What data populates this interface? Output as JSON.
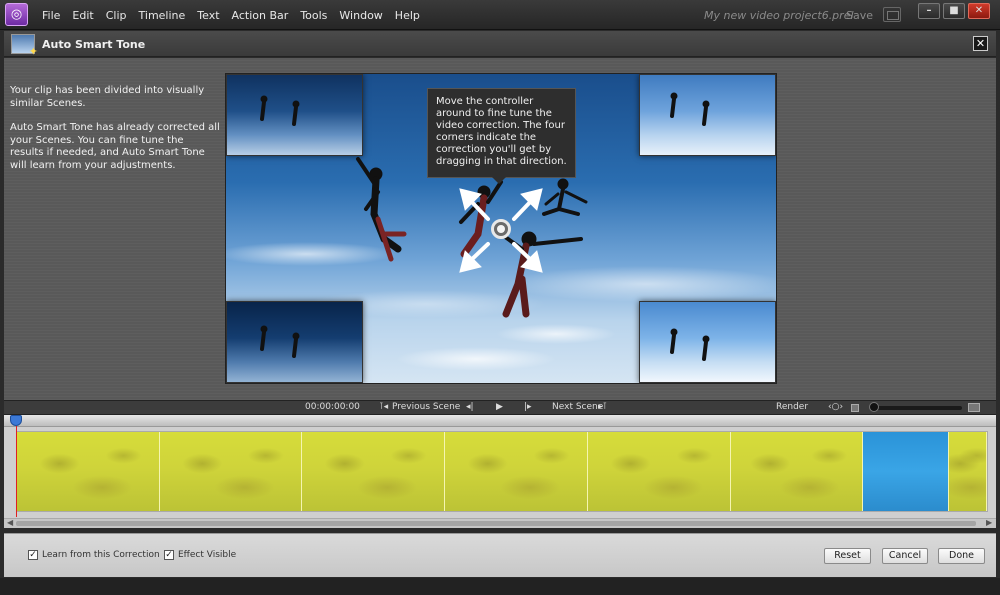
{
  "menubar": {
    "logo_glyph": "◎",
    "items": [
      "File",
      "Edit",
      "Clip",
      "Timeline",
      "Text",
      "Action Bar",
      "Tools",
      "Window",
      "Help"
    ],
    "project_name": "My new video project6.prel",
    "save_label": "Save",
    "window_controls": [
      "–",
      "■",
      "✕"
    ]
  },
  "panel": {
    "title": "Auto Smart Tone",
    "close_glyph": "✕"
  },
  "instructions": {
    "para1": "Your clip has been divided into visually similar Scenes.",
    "para2": "Auto Smart Tone has already corrected all your Scenes. You can fine tune the results if needed, and Auto Smart Tone will learn from your adjustments."
  },
  "preview": {
    "tooltip": "Move the controller around to fine tune the video correction. The four corners indicate the correction you'll get by dragging in that direction."
  },
  "transport": {
    "timecode": "00:00:00:00",
    "previous_scene": "Previous Scene",
    "previous_scene_icon": "⊺◂",
    "step_back_icon": "◂|",
    "play_icon": "▶",
    "step_forward_icon": "|▸",
    "next_scene": "Next Scene",
    "next_scene_icon": "▸⊺",
    "render": "Render",
    "zoom_icon": "‹○›"
  },
  "timeline": {
    "scenes": [
      {
        "name": "scene-1",
        "tint": "yellow"
      },
      {
        "name": "scene-2",
        "tint": "yellow"
      },
      {
        "name": "scene-3",
        "tint": "yellow"
      },
      {
        "name": "scene-4",
        "tint": "yellow"
      },
      {
        "name": "scene-5",
        "tint": "yellow"
      },
      {
        "name": "scene-6",
        "tint": "yellow"
      },
      {
        "name": "scene-7",
        "tint": "blue"
      },
      {
        "name": "scene-8",
        "tint": "yellow"
      }
    ],
    "colors": {
      "yellow": "#d6dc3a",
      "blue": "#3aa5e6",
      "playhead": "#e02020"
    }
  },
  "bottom": {
    "learn_label": "Learn from this Correction",
    "learn_checked": true,
    "effect_visible_label": "Effect Visible",
    "effect_visible_checked": true,
    "reset": "Reset",
    "cancel": "Cancel",
    "done": "Done"
  }
}
